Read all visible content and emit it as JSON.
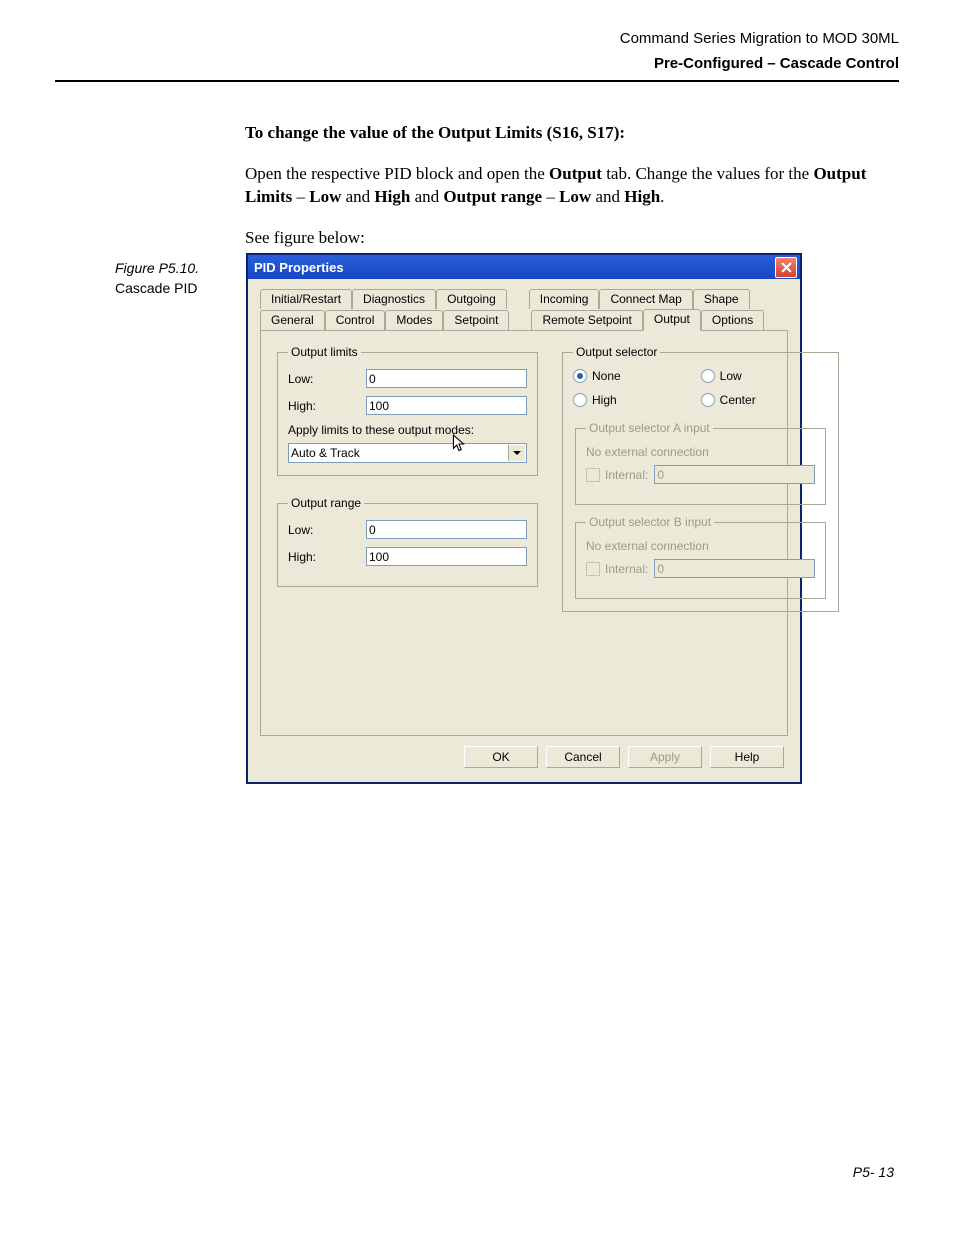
{
  "header": {
    "line1": "Command Series Migration to MOD 30ML",
    "line2": "Pre-Configured – Cascade Control"
  },
  "body": {
    "heading": "To change the value of the Output Limits (S16, S17):",
    "para_before": "Open the respective PID block and open the ",
    "para_bold1": "Output",
    "para_mid1": " tab. Change the values for the ",
    "para_bold2": "Output Limits",
    "para_mid2": " – ",
    "para_bold3": "Low",
    "para_mid3": " and ",
    "para_bold4": "High",
    "para_mid4": " and ",
    "para_bold5": "Output range",
    "para_mid5": " – ",
    "para_bold6": "Low",
    "para_mid6": " and ",
    "para_bold7": "High",
    "para_end": ".",
    "see_figure": "See figure below:"
  },
  "figure": {
    "label": "Figure P5.10.",
    "caption": "Cascade PID"
  },
  "dialog": {
    "title": "PID Properties",
    "tabs_row1": [
      "Initial/Restart",
      "Diagnostics",
      "Outgoing",
      "Incoming",
      "Connect Map",
      "Shape"
    ],
    "tabs_row2": [
      "General",
      "Control",
      "Modes",
      "Setpoint",
      "Remote Setpoint",
      "Output",
      "Options"
    ],
    "active_tab": "Output",
    "output_limits": {
      "legend": "Output limits",
      "low_label": "Low:",
      "low_value": "0",
      "high_label": "High:",
      "high_value": "100",
      "apply_label": "Apply limits to these output modes:",
      "apply_value": "Auto & Track"
    },
    "output_range": {
      "legend": "Output range",
      "low_label": "Low:",
      "low_value": "0",
      "high_label": "High:",
      "high_value": "100"
    },
    "output_selector": {
      "legend": "Output selector",
      "options": {
        "none": "None",
        "low": "Low",
        "high": "High",
        "center": "Center"
      },
      "selected": "none"
    },
    "sel_a": {
      "legend": "Output selector A input",
      "static": "No external connection",
      "internal_label": "Internal:",
      "internal_value": "0"
    },
    "sel_b": {
      "legend": "Output selector B input",
      "static": "No external connection",
      "internal_label": "Internal:",
      "internal_value": "0"
    },
    "buttons": {
      "ok": "OK",
      "cancel": "Cancel",
      "apply": "Apply",
      "help": "Help"
    }
  },
  "page_number": "P5- 13"
}
